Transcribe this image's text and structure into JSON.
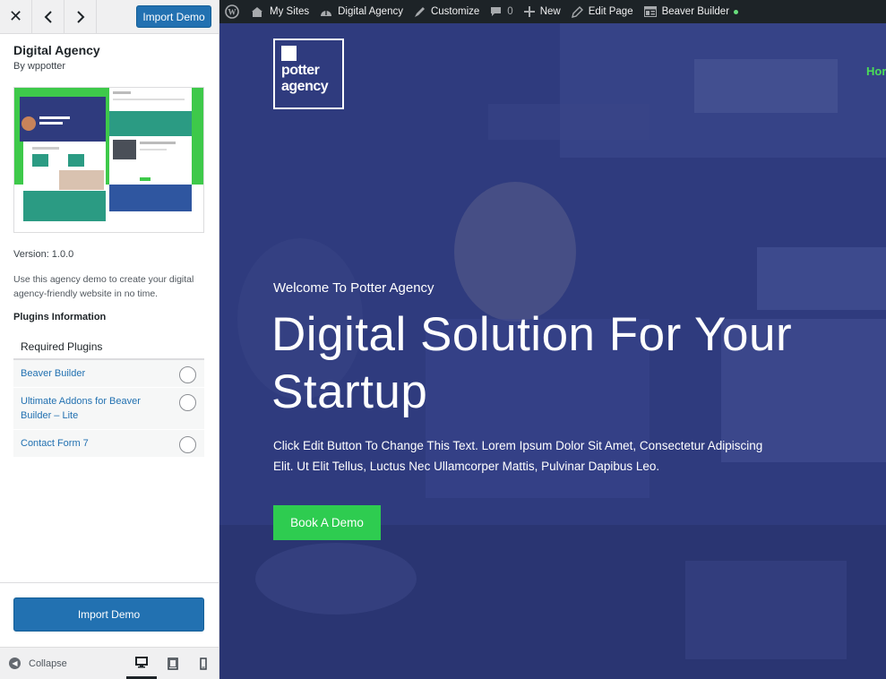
{
  "sidebar": {
    "top_import_label": "Import Demo",
    "theme": {
      "title": "Digital Agency",
      "author": "By wppotter",
      "version": "Version: 1.0.0",
      "description": "Use this agency demo to create your digital agency-friendly website in no time."
    },
    "plugins_heading": "Plugins Information",
    "required_label": "Required Plugins",
    "plugins": [
      {
        "name": "Beaver Builder"
      },
      {
        "name": "Ultimate Addons for Beaver Builder – Lite"
      },
      {
        "name": "Contact Form 7"
      }
    ],
    "import_button_label": "Import Demo",
    "collapse_label": "Collapse"
  },
  "adminbar": {
    "my_sites": "My Sites",
    "site_name": "Digital Agency",
    "customize": "Customize",
    "comments_count": "0",
    "new": "New",
    "edit_page": "Edit Page",
    "beaver_builder": "Beaver Builder"
  },
  "preview": {
    "logo_line1": "potter",
    "logo_line2": "agency",
    "nav_home": "Hor",
    "welcome": "Welcome To Potter Agency",
    "hero_title": "Digital Solution For Your Startup",
    "hero_body": "Click Edit Button To Change This Text. Lorem Ipsum Dolor Sit Amet, Consectetur Adipiscing Elit. Ut Elit Tellus, Luctus Nec Ullamcorper Mattis, Pulvinar Dapibus Leo.",
    "cta": "Book A Demo"
  },
  "colors": {
    "wp_blue": "#2271b1",
    "admin_bar": "#1d2327",
    "hero_overlay": "#2f3b7e",
    "accent_green": "#2ecc50"
  }
}
